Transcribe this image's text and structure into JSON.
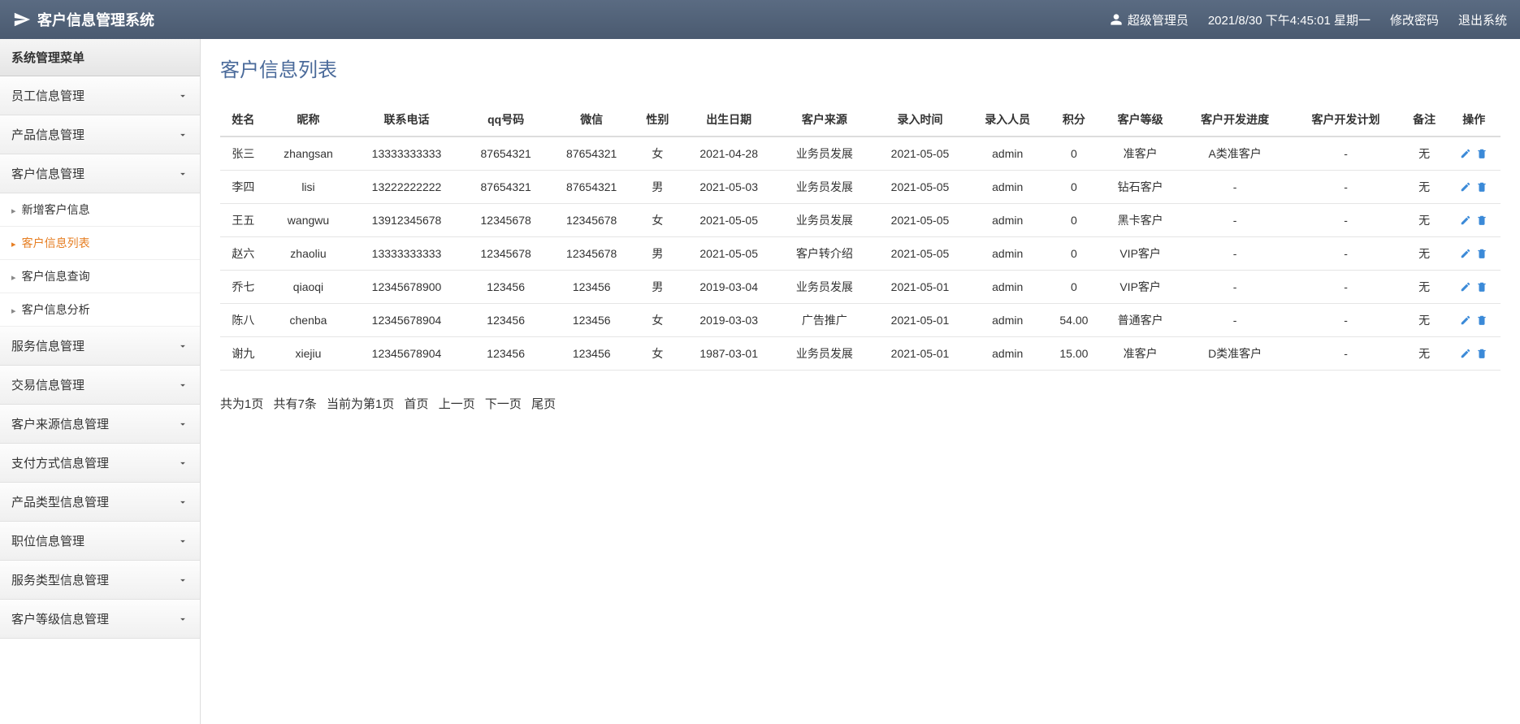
{
  "header": {
    "title": "客户信息管理系统",
    "user_label": "超级管理员",
    "datetime": "2021/8/30 下午4:45:01 星期一",
    "change_pwd": "修改密码",
    "logout": "退出系统"
  },
  "sidebar": {
    "title": "系统管理菜单",
    "items": [
      {
        "label": "员工信息管理",
        "expanded": false
      },
      {
        "label": "产品信息管理",
        "expanded": false
      },
      {
        "label": "客户信息管理",
        "expanded": true,
        "children": [
          {
            "label": "新增客户信息",
            "active": false
          },
          {
            "label": "客户信息列表",
            "active": true
          },
          {
            "label": "客户信息查询",
            "active": false
          },
          {
            "label": "客户信息分析",
            "active": false
          }
        ]
      },
      {
        "label": "服务信息管理",
        "expanded": false
      },
      {
        "label": "交易信息管理",
        "expanded": false
      },
      {
        "label": "客户来源信息管理",
        "expanded": false
      },
      {
        "label": "支付方式信息管理",
        "expanded": false
      },
      {
        "label": "产品类型信息管理",
        "expanded": false
      },
      {
        "label": "职位信息管理",
        "expanded": false
      },
      {
        "label": "服务类型信息管理",
        "expanded": false
      },
      {
        "label": "客户等级信息管理",
        "expanded": false
      }
    ]
  },
  "main": {
    "title": "客户信息列表",
    "columns": [
      "姓名",
      "昵称",
      "联系电话",
      "qq号码",
      "微信",
      "性别",
      "出生日期",
      "客户来源",
      "录入时间",
      "录入人员",
      "积分",
      "客户等级",
      "客户开发进度",
      "客户开发计划",
      "备注",
      "操作"
    ],
    "rows": [
      {
        "name": "张三",
        "nick": "zhangsan",
        "phone": "13333333333",
        "qq": "87654321",
        "wechat": "87654321",
        "gender": "女",
        "birth": "2021-04-28",
        "source": "业务员发展",
        "entry": "2021-05-05",
        "by": "admin",
        "points": "0",
        "level": "准客户",
        "progress": "A类准客户",
        "plan": "-",
        "remark": "无"
      },
      {
        "name": "李四",
        "nick": "lisi",
        "phone": "13222222222",
        "qq": "87654321",
        "wechat": "87654321",
        "gender": "男",
        "birth": "2021-05-03",
        "source": "业务员发展",
        "entry": "2021-05-05",
        "by": "admin",
        "points": "0",
        "level": "钻石客户",
        "progress": "-",
        "plan": "-",
        "remark": "无"
      },
      {
        "name": "王五",
        "nick": "wangwu",
        "phone": "13912345678",
        "qq": "12345678",
        "wechat": "12345678",
        "gender": "女",
        "birth": "2021-05-05",
        "source": "业务员发展",
        "entry": "2021-05-05",
        "by": "admin",
        "points": "0",
        "level": "黑卡客户",
        "progress": "-",
        "plan": "-",
        "remark": "无"
      },
      {
        "name": "赵六",
        "nick": "zhaoliu",
        "phone": "13333333333",
        "qq": "12345678",
        "wechat": "12345678",
        "gender": "男",
        "birth": "2021-05-05",
        "source": "客户转介绍",
        "entry": "2021-05-05",
        "by": "admin",
        "points": "0",
        "level": "VIP客户",
        "progress": "-",
        "plan": "-",
        "remark": "无"
      },
      {
        "name": "乔七",
        "nick": "qiaoqi",
        "phone": "12345678900",
        "qq": "123456",
        "wechat": "123456",
        "gender": "男",
        "birth": "2019-03-04",
        "source": "业务员发展",
        "entry": "2021-05-01",
        "by": "admin",
        "points": "0",
        "level": "VIP客户",
        "progress": "-",
        "plan": "-",
        "remark": "无"
      },
      {
        "name": "陈八",
        "nick": "chenba",
        "phone": "12345678904",
        "qq": "123456",
        "wechat": "123456",
        "gender": "女",
        "birth": "2019-03-03",
        "source": "广告推广",
        "entry": "2021-05-01",
        "by": "admin",
        "points": "54.00",
        "level": "普通客户",
        "progress": "-",
        "plan": "-",
        "remark": "无"
      },
      {
        "name": "谢九",
        "nick": "xiejiu",
        "phone": "12345678904",
        "qq": "123456",
        "wechat": "123456",
        "gender": "女",
        "birth": "1987-03-01",
        "source": "业务员发展",
        "entry": "2021-05-01",
        "by": "admin",
        "points": "15.00",
        "level": "准客户",
        "progress": "D类准客户",
        "plan": "-",
        "remark": "无"
      }
    ],
    "pagination": {
      "total_pages": "共为1页",
      "total_items": "共有7条",
      "current": "当前为第1页",
      "first": "首页",
      "prev": "上一页",
      "next": "下一页",
      "last": "尾页"
    }
  },
  "icons": {
    "edit_color": "#3b8ad8",
    "delete_color": "#3b8ad8"
  }
}
